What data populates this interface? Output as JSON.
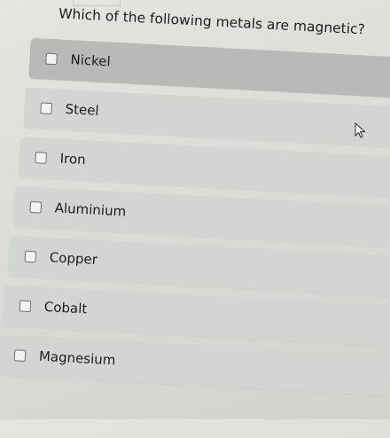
{
  "question": "Which of the following metals are magnetic?",
  "options": [
    {
      "label": "Nickel",
      "checked": false
    },
    {
      "label": "Steel",
      "checked": false
    },
    {
      "label": "Iron",
      "checked": false
    },
    {
      "label": "Aluminium",
      "checked": false
    },
    {
      "label": "Copper",
      "checked": false
    },
    {
      "label": "Cobalt",
      "checked": false
    },
    {
      "label": "Magnesium",
      "checked": false
    }
  ],
  "colors": {
    "option_bg": "#d3d5d2",
    "option_hover_bg": "#b9bab7",
    "text": "#1c1d1f"
  },
  "icons": {
    "checkbox": "checkbox-icon",
    "cursor": "mouse-pointer-icon"
  }
}
